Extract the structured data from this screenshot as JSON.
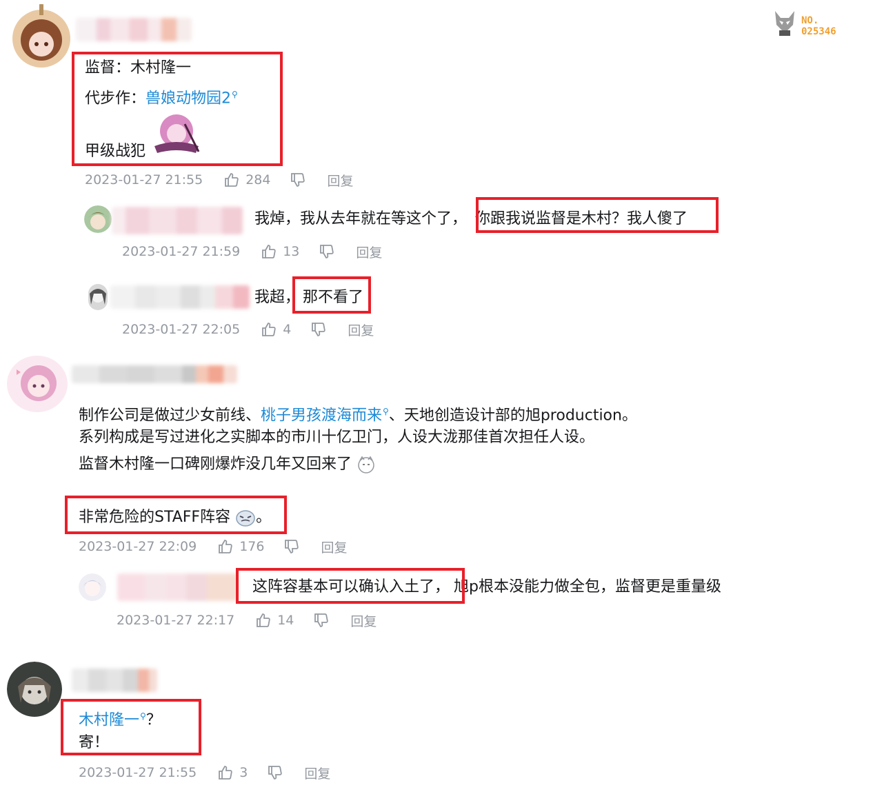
{
  "badge": {
    "line1": "NO.",
    "line2": "025346"
  },
  "comments": [
    {
      "lines": [
        {
          "label": "监督：",
          "value": "木村隆一"
        },
        {
          "label": "代步作：",
          "link": "兽娘动物园2"
        },
        {
          "text": "甲级战犯"
        }
      ],
      "time": "2023-01-27 21:55",
      "likes": "284",
      "reply_label": "回复",
      "replies": [
        {
          "text_plain": "我焯，我从去年就在等这个了，",
          "text_highlight": "你跟我说监督是木村？我人傻了",
          "time": "2023-01-27 21:59",
          "likes": "13",
          "reply_label": "回复"
        },
        {
          "text_plain": "我超，",
          "text_highlight": "那不看了",
          "time": "2023-01-27 22:05",
          "likes": "4",
          "reply_label": "回复"
        }
      ]
    },
    {
      "line1_a": "制作公司是做过少女前线、",
      "line1_link": "桃子男孩渡海而来",
      "line1_b": "、天地创造设计部的旭production。",
      "line2": "系列构成是写过进化之实脚本的市川十亿卫门，人设大泷那佳首次担任人设。",
      "line3": "监督木村隆一口碑刚爆炸没几年又回来了",
      "line4_a": "非常危险的STAFF阵容",
      "line4_b": "。",
      "time": "2023-01-27 22:09",
      "likes": "176",
      "reply_label": "回复",
      "replies": [
        {
          "text_highlight": "这阵容基本可以确认入土了，",
          "text_plain": "旭p根本没能力做全包，监督更是重量级",
          "time": "2023-01-27 22:17",
          "likes": "14",
          "reply_label": "回复"
        }
      ]
    },
    {
      "line1_link": "木村隆一",
      "line1_b": "？",
      "line2": "寄！",
      "time": "2023-01-27 21:55",
      "likes": "3",
      "reply_label": "回复"
    }
  ]
}
